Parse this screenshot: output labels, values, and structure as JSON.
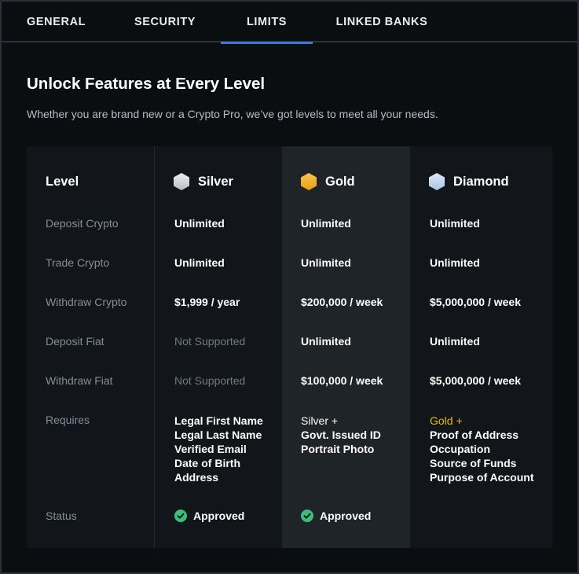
{
  "tabs": [
    {
      "label": "GENERAL",
      "active": false
    },
    {
      "label": "SECURITY",
      "active": false
    },
    {
      "label": "LIMITS",
      "active": true
    },
    {
      "label": "LINKED BANKS",
      "active": false
    }
  ],
  "accent_color": "#3b78d8",
  "page": {
    "title": "Unlock Features at Every Level",
    "subtitle": "Whether you are brand new or a Crypto Pro, we’ve got levels to meet all your needs."
  },
  "table": {
    "row_labels": {
      "header": "Level",
      "rows": [
        "Deposit Crypto",
        "Trade Crypto",
        "Withdraw Crypto",
        "Deposit Fiat",
        "Withdraw Fiat",
        "Requires",
        "Status"
      ]
    },
    "levels": [
      {
        "name": "Silver",
        "icon": "silver-hexagon-icon",
        "icon_color": "#d5d8de",
        "deposit_crypto": "Unlimited",
        "trade_crypto": "Unlimited",
        "withdraw_crypto": "$1,999 / year",
        "deposit_fiat": "Not Supported",
        "withdraw_fiat": "Not Supported",
        "requires": [
          "Legal First Name",
          "Legal Last Name",
          "Verified Email",
          "Date of Birth",
          "Address"
        ],
        "status": "Approved"
      },
      {
        "name": "Gold",
        "icon": "gold-hexagon-icon",
        "icon_color": "#f0b429",
        "deposit_crypto": "Unlimited",
        "trade_crypto": "Unlimited",
        "withdraw_crypto": "$200,000 / week",
        "deposit_fiat": "Unlimited",
        "withdraw_fiat": "$100,000 / week",
        "requires": [
          "Silver +",
          "Govt. Issued ID",
          "Portrait Photo"
        ],
        "status": "Approved"
      },
      {
        "name": "Diamond",
        "icon": "diamond-hexagon-icon",
        "icon_color": "#c4d8ee",
        "deposit_crypto": "Unlimited",
        "trade_crypto": "Unlimited",
        "withdraw_crypto": "$5,000,000 / week",
        "deposit_fiat": "Unlimited",
        "withdraw_fiat": "$5,000,000 / week",
        "requires": [
          "Gold +",
          "Proof of Address",
          "Occupation",
          "Source of Funds",
          "Purpose of Account"
        ],
        "status": ""
      }
    ],
    "status_color": "#3dbd7d"
  }
}
